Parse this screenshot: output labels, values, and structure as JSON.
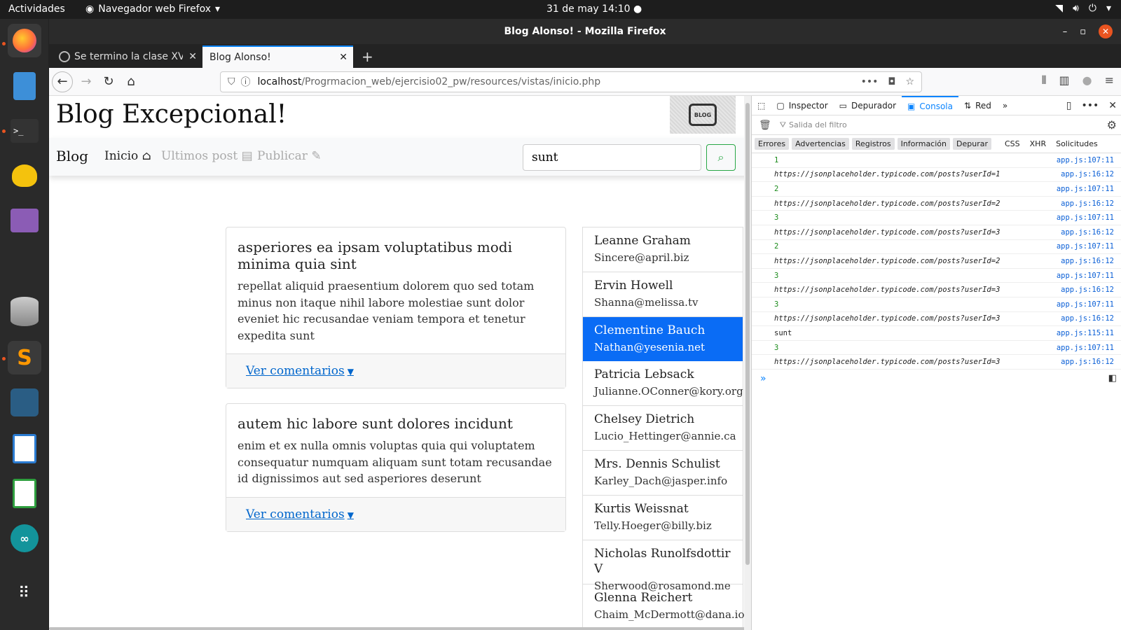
{
  "topbar": {
    "activities": "Actividades",
    "app_menu": "Navegador web Firefox",
    "clock": "31 de may  14:10"
  },
  "window": {
    "title": "Blog Alonso! - Mozilla Firefox"
  },
  "tabs": [
    {
      "label": "Se termino la clase XV · A"
    },
    {
      "label": "Blog Alonso!"
    }
  ],
  "urlbar": {
    "host": "localhost",
    "path": "/Progrmacion_web/ejercisio02_pw/resources/vistas/inicio.php"
  },
  "site": {
    "title": "Blog Excepcional!",
    "logo_text": "BLOG",
    "nav": {
      "brand": "Blog",
      "inicio": "Inicio",
      "ultimos": "Ultimos post",
      "publicar": "Publicar"
    },
    "search_value": "sunt"
  },
  "posts": [
    {
      "title": "asperiores ea ipsam voluptatibus modi minima quia sint",
      "body": "repellat aliquid praesentium dolorem quo sed totam minus non itaque nihil labore molestiae sunt dolor eveniet hic recusandae veniam tempora et tenetur expedita sunt",
      "link": "Ver comentarios"
    },
    {
      "title": "autem hic labore sunt dolores incidunt",
      "body": "enim et ex nulla omnis voluptas quia qui voluptatem consequatur numquam aliquam sunt totam recusandae id dignissimos aut sed asperiores deserunt",
      "link": "Ver comentarios"
    }
  ],
  "users": [
    {
      "name": "Leanne Graham",
      "email": "Sincere@april.biz"
    },
    {
      "name": "Ervin Howell",
      "email": "Shanna@melissa.tv"
    },
    {
      "name": "Clementine Bauch",
      "email": "Nathan@yesenia.net"
    },
    {
      "name": "Patricia Lebsack",
      "email": "Julianne.OConner@kory.org"
    },
    {
      "name": "Chelsey Dietrich",
      "email": "Lucio_Hettinger@annie.ca"
    },
    {
      "name": "Mrs. Dennis Schulist",
      "email": "Karley_Dach@jasper.info"
    },
    {
      "name": "Kurtis Weissnat",
      "email": "Telly.Hoeger@billy.biz"
    },
    {
      "name": "Nicholas Runolfsdottir V",
      "email": "Sherwood@rosamond.me"
    },
    {
      "name": "Glenna Reichert",
      "email": "Chaim_McDermott@dana.io"
    }
  ],
  "devtools": {
    "tabs": {
      "inspector": "Inspector",
      "depurador": "Depurador",
      "consola": "Consola",
      "red": "Red"
    },
    "filter_placeholder": "Salida del filtro",
    "levels": {
      "errores": "Errores",
      "advertencias": "Advertencias",
      "registros": "Registros",
      "informacion": "Información",
      "depurar": "Depurar",
      "css": "CSS",
      "xhr": "XHR",
      "solicitudes": "Solicitudes"
    },
    "logs": [
      {
        "msg": "1",
        "src": "app.js:107:11"
      },
      {
        "msg": "https://jsonplaceholder.typicode.com/posts?userId=1",
        "src": "app.js:16:12"
      },
      {
        "msg": "2",
        "src": "app.js:107:11"
      },
      {
        "msg": "https://jsonplaceholder.typicode.com/posts?userId=2",
        "src": "app.js:16:12"
      },
      {
        "msg": "3",
        "src": "app.js:107:11"
      },
      {
        "msg": "https://jsonplaceholder.typicode.com/posts?userId=3",
        "src": "app.js:16:12"
      },
      {
        "msg": "2",
        "src": "app.js:107:11"
      },
      {
        "msg": "https://jsonplaceholder.typicode.com/posts?userId=2",
        "src": "app.js:16:12"
      },
      {
        "msg": "3",
        "src": "app.js:107:11"
      },
      {
        "msg": "https://jsonplaceholder.typicode.com/posts?userId=3",
        "src": "app.js:16:12"
      },
      {
        "msg": "3",
        "src": "app.js:107:11"
      },
      {
        "msg": "https://jsonplaceholder.typicode.com/posts?userId=3",
        "src": "app.js:16:12"
      },
      {
        "msg": "sunt",
        "src": "app.js:115:11"
      },
      {
        "msg": "3",
        "src": "app.js:107:11"
      },
      {
        "msg": "https://jsonplaceholder.typicode.com/posts?userId=3",
        "src": "app.js:16:12"
      }
    ]
  }
}
